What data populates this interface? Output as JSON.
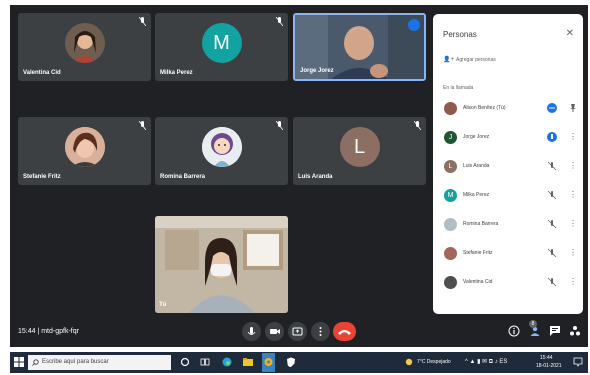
{
  "participants": [
    {
      "name": "Valentina Cid",
      "avatar": "photo"
    },
    {
      "name": "Milka Perez",
      "letter": "M",
      "color": "#12a2a2"
    },
    {
      "name": "Jorge Jorez",
      "avatar": "video",
      "speaking": true
    },
    {
      "name": "Stefanie Fritz",
      "avatar": "photo"
    },
    {
      "name": "Romina Barrera",
      "avatar": "illustration"
    },
    {
      "name": "Luis Aranda",
      "letter": "L",
      "color": "#8d6e63"
    }
  ],
  "self_view": {
    "name_fragment": "Tú"
  },
  "people_panel": {
    "title": "Personas",
    "add_label": "Agregar personas",
    "section_label": "En la llamada",
    "members": [
      {
        "name": "Alison Benítez (Tú)",
        "mic": "active",
        "avatar_color": "#8e5a4a"
      },
      {
        "name": "Jorge Jorez",
        "mic": "speaking",
        "avatar_letter": "J",
        "avatar_color": "#1e5631"
      },
      {
        "name": "Luis Aranda",
        "mic": "muted",
        "avatar_letter": "L",
        "avatar_color": "#8d6e63"
      },
      {
        "name": "Milka Perez",
        "mic": "muted",
        "avatar_letter": "M",
        "avatar_color": "#12a2a2"
      },
      {
        "name": "Romina Barrera",
        "mic": "muted",
        "avatar_color": "#b0bec5"
      },
      {
        "name": "Stefanie Fritz",
        "mic": "muted",
        "avatar_color": "#a1675a"
      },
      {
        "name": "Valentina Cid",
        "mic": "muted",
        "avatar_color": "#4e4e4e"
      }
    ]
  },
  "bottom_bar": {
    "meeting_time_code": "15:44 | mtd-gpfk-fqr",
    "people_count": "8"
  },
  "taskbar": {
    "search_placeholder": "Escribe aquí para buscar",
    "weather": "7°C Despejado",
    "clock_time": "15:44",
    "clock_date": "18-01-2021"
  }
}
